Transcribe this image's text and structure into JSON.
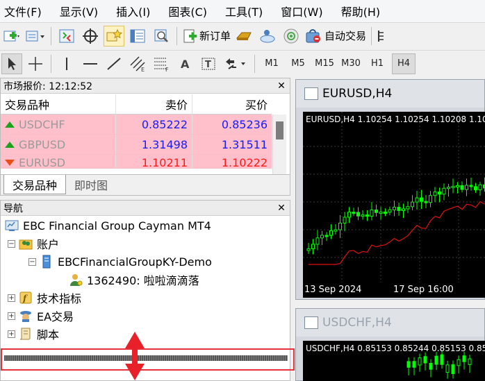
{
  "menu": [
    "文件(F)",
    "显示(V)",
    "插入(I)",
    "图表(C)",
    "工具(T)",
    "窗口(W)",
    "帮助(H)"
  ],
  "toolbar": {
    "new_order_label": "新订单",
    "auto_trade_label": "自动交易",
    "timeframes": [
      "M1",
      "M5",
      "M15",
      "M30",
      "H1",
      "H4"
    ],
    "active_timeframe": "H4"
  },
  "market_watch": {
    "title": "市场报价: 12:12:52",
    "columns": [
      "交易品种",
      "卖价",
      "买价"
    ],
    "rows": [
      {
        "symbol": "USDCHF",
        "bid": "0.85222",
        "ask": "0.85236",
        "direction": "up"
      },
      {
        "symbol": "GBPUSD",
        "bid": "1.31498",
        "ask": "1.31511",
        "direction": "up"
      },
      {
        "symbol": "EURUSD",
        "bid": "1.10211",
        "ask": "1.10222",
        "direction": "down"
      }
    ],
    "tabs": [
      "交易品种",
      "即时图"
    ]
  },
  "navigator": {
    "title": "导航",
    "root": "EBC Financial Group Cayman MT4",
    "accounts": "账户",
    "server": "EBCFinancialGroupKY-Demo",
    "account": "1362490: 啦啦滴滴落",
    "indicators": "技术指标",
    "experts": "EA交易",
    "scripts": "脚本"
  },
  "charts": [
    {
      "title": "EURUSD,H4",
      "info": "EURUSD,H4  1.10254 1.10254 1.10208 1.10",
      "x_labels": [
        "13 Sep 2024",
        "17 Sep 16:00"
      ]
    },
    {
      "title": "USDCHF,H4",
      "info": "USDCHF,H4  0.85153 0.85244 0.85153 0.85"
    }
  ],
  "colors": {
    "bid_ask_up": "#1a1aff",
    "bid_ask_down": "#ff1a1a",
    "row_highlight": "#ffc0cb",
    "bull_candle": "#00ff00",
    "ma_line": "#ff0000"
  }
}
